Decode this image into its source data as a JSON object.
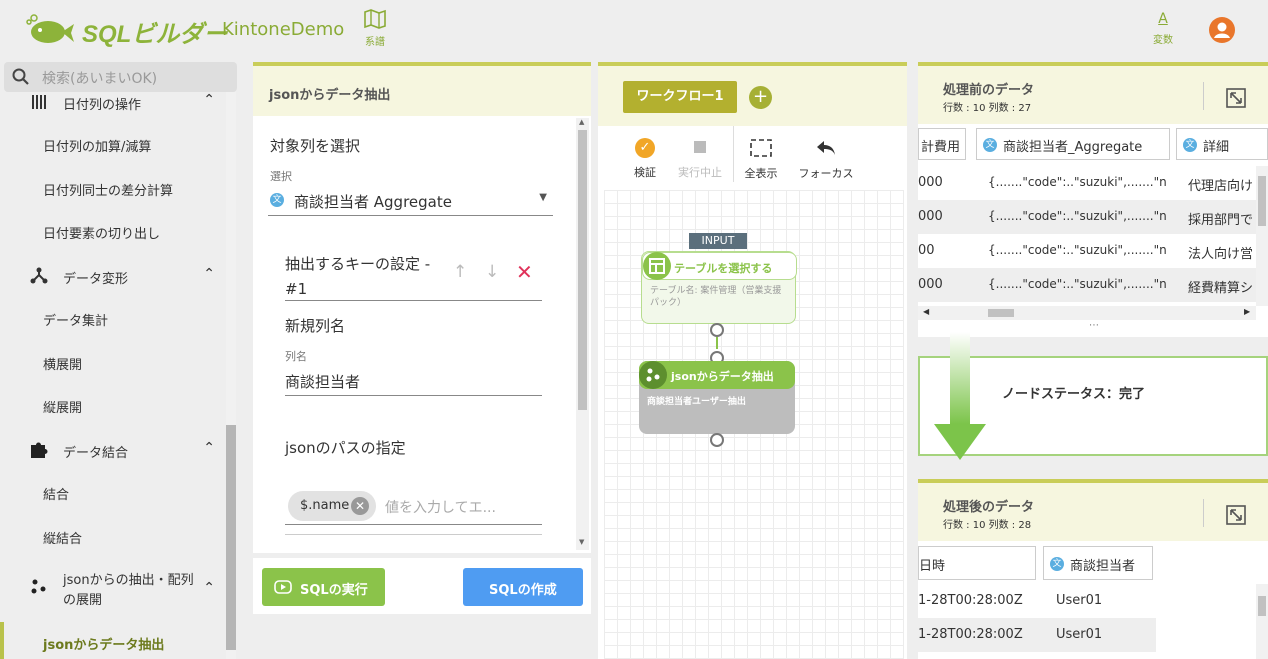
{
  "header": {
    "logo_text": "SQLビルダー",
    "app_name": "KintoneDemo",
    "lineage_label": "系譜",
    "vars_label": "変数"
  },
  "sidebar": {
    "search_placeholder": "検索(あいまいOK)",
    "items": [
      {
        "label": "日付列の操作",
        "type": "category",
        "icon": "columns-icon"
      },
      {
        "label": "日付列の加算/減算",
        "type": "item"
      },
      {
        "label": "日付列同士の差分計算",
        "type": "item"
      },
      {
        "label": "日付要素の切り出し",
        "type": "item"
      },
      {
        "label": "データ変形",
        "type": "category",
        "icon": "branch-icon"
      },
      {
        "label": "データ集計",
        "type": "item"
      },
      {
        "label": "横展開",
        "type": "item"
      },
      {
        "label": "縦展開",
        "type": "item"
      },
      {
        "label": "データ結合",
        "type": "category",
        "icon": "puzzle-icon"
      },
      {
        "label": "結合",
        "type": "item"
      },
      {
        "label": "縦結合",
        "type": "item"
      },
      {
        "label": "jsonからの抽出・配列の展開",
        "type": "category",
        "icon": "dots-icon"
      },
      {
        "label": "jsonからデータ抽出",
        "type": "active"
      }
    ]
  },
  "settings": {
    "title": "jsonからデータ抽出",
    "target_col_label": "対象列を選択",
    "select_label": "選択",
    "select_value": "商談担当者 Aggregate",
    "key_setting_label": "抽出するキーの設定 -",
    "key_index": "#1",
    "new_col_label": "新規列名",
    "col_name_label": "列名",
    "col_name_value": "商談担当者",
    "json_path_label": "jsonのパスの指定",
    "chip_value": "$.name",
    "path_placeholder": "値を入力してエ...",
    "exec_button": "SQLの実行",
    "create_button": "SQLの作成"
  },
  "workflow": {
    "tab": "ワークフロー1",
    "tools": {
      "validate": "検証",
      "stop": "実行中止",
      "fit": "全表示",
      "focus": "フォーカス"
    },
    "input_label": "INPUT",
    "node1_title": "テーブルを選択する",
    "node1_desc": "テーブル名: 案件管理（営業支援パック）",
    "node2_title": "jsonからデータ抽出",
    "node2_desc": "商談担当者ユーザー抽出"
  },
  "before": {
    "title": "処理前のデータ",
    "stats": "行数 : 10 列数 : 27",
    "columns": [
      "計費用",
      "商談担当者_Aggregate",
      "詳細"
    ],
    "rows": [
      [
        "000",
        "{.......\"code\":..\"suzuki\",.......\"n...",
        "代理店向け"
      ],
      [
        "000",
        "{.......\"code\":..\"suzuki\",.......\"n...",
        "採用部門で"
      ],
      [
        "00",
        "{.......\"code\":..\"suzuki\",.......\"n...",
        "法人向け営"
      ],
      [
        "000",
        "{.......\"code\":..\"suzuki\",.......\"n...",
        "経費精算シ"
      ]
    ]
  },
  "status": {
    "text": "ノードステータス：完了"
  },
  "after": {
    "title": "処理後のデータ",
    "stats": "行数 : 10 列数 : 28",
    "columns": [
      "日時",
      "商談担当者"
    ],
    "rows": [
      [
        "1-28T00:28:00Z",
        "User01"
      ],
      [
        "1-28T00:28:00Z",
        "User01"
      ]
    ]
  },
  "colors": {
    "brand": "#8bc34a",
    "accent": "#c9cd58",
    "primary": "#4f9cf2",
    "avatar": "#e9762b"
  }
}
